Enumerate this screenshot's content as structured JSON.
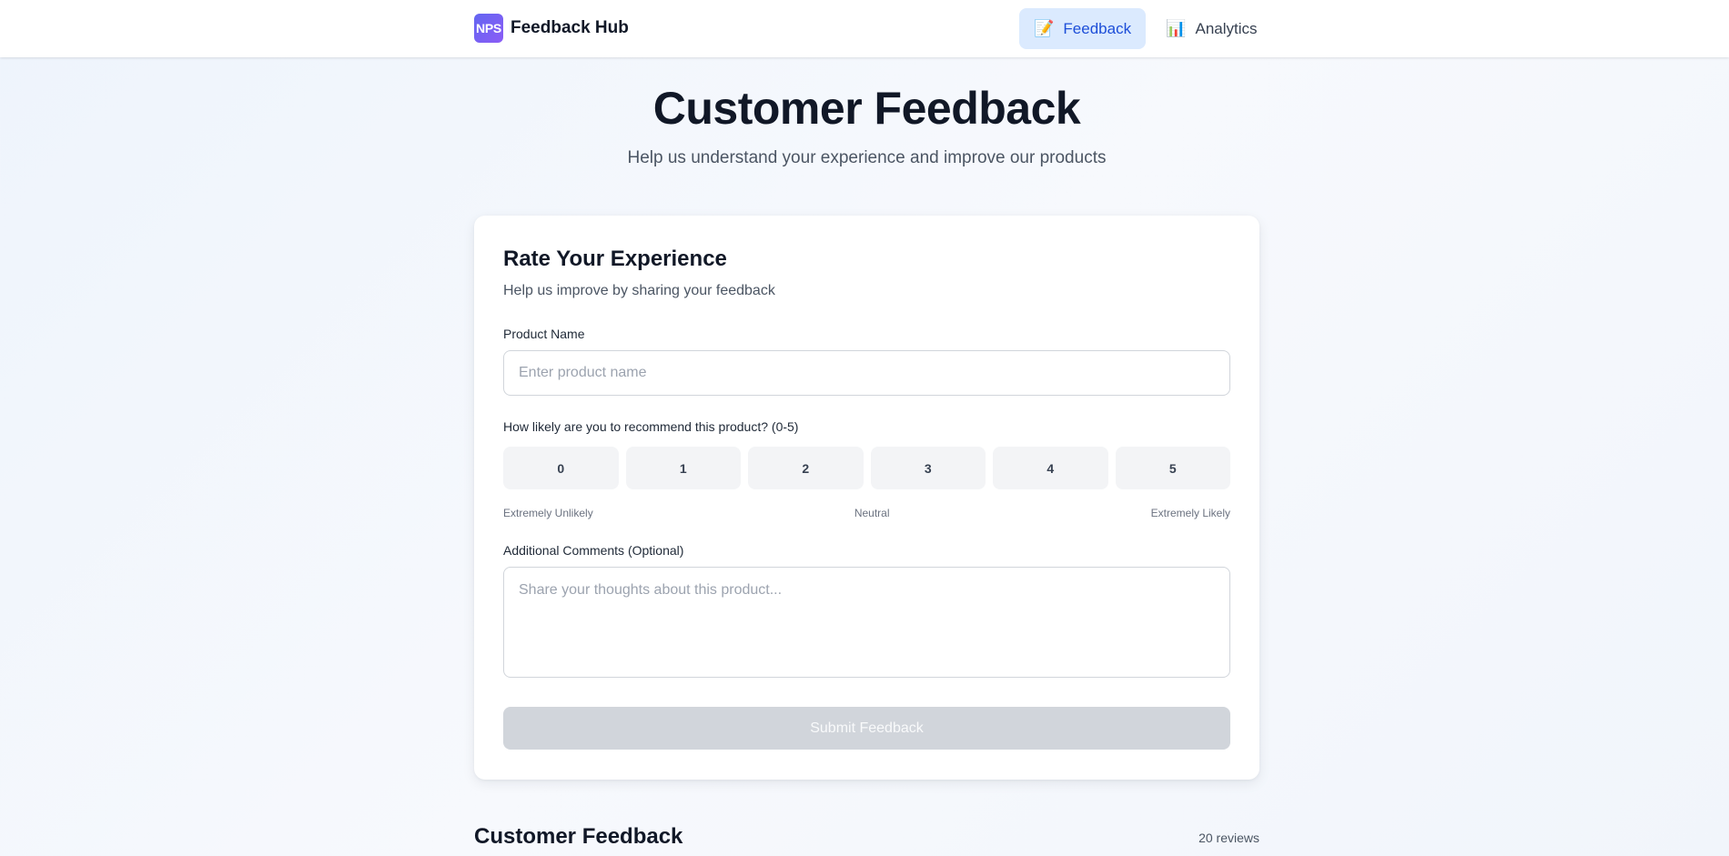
{
  "brand": {
    "logo_text": "NPS",
    "name": "Feedback Hub"
  },
  "nav": [
    {
      "icon": "📝",
      "icon_name": "memo-icon",
      "label": "Feedback",
      "active": true
    },
    {
      "icon": "📊",
      "icon_name": "bar-chart-icon",
      "label": "Analytics",
      "active": false
    }
  ],
  "hero": {
    "title": "Customer Feedback",
    "subtitle": "Help us understand your experience and improve our products"
  },
  "form": {
    "title": "Rate Your Experience",
    "subtitle": "Help us improve by sharing your feedback",
    "product_label": "Product Name",
    "product_placeholder": "Enter product name",
    "product_value": "",
    "rating_label": "How likely are you to recommend this product? (0-5)",
    "ratings": [
      "0",
      "1",
      "2",
      "3",
      "4",
      "5"
    ],
    "scale": {
      "low": "Extremely Unlikely",
      "mid": "Neutral",
      "high": "Extremely Likely"
    },
    "comments_label": "Additional Comments (Optional)",
    "comments_placeholder": "Share your thoughts about this product...",
    "submit_label": "Submit Feedback"
  },
  "reviews": {
    "title": "Customer Feedback",
    "count": "20 reviews"
  },
  "colors": {
    "accent": "#1d4ed8",
    "active_nav_bg": "#dbeafe",
    "logo_from": "#6366f1",
    "logo_to": "#8b5cf6"
  }
}
